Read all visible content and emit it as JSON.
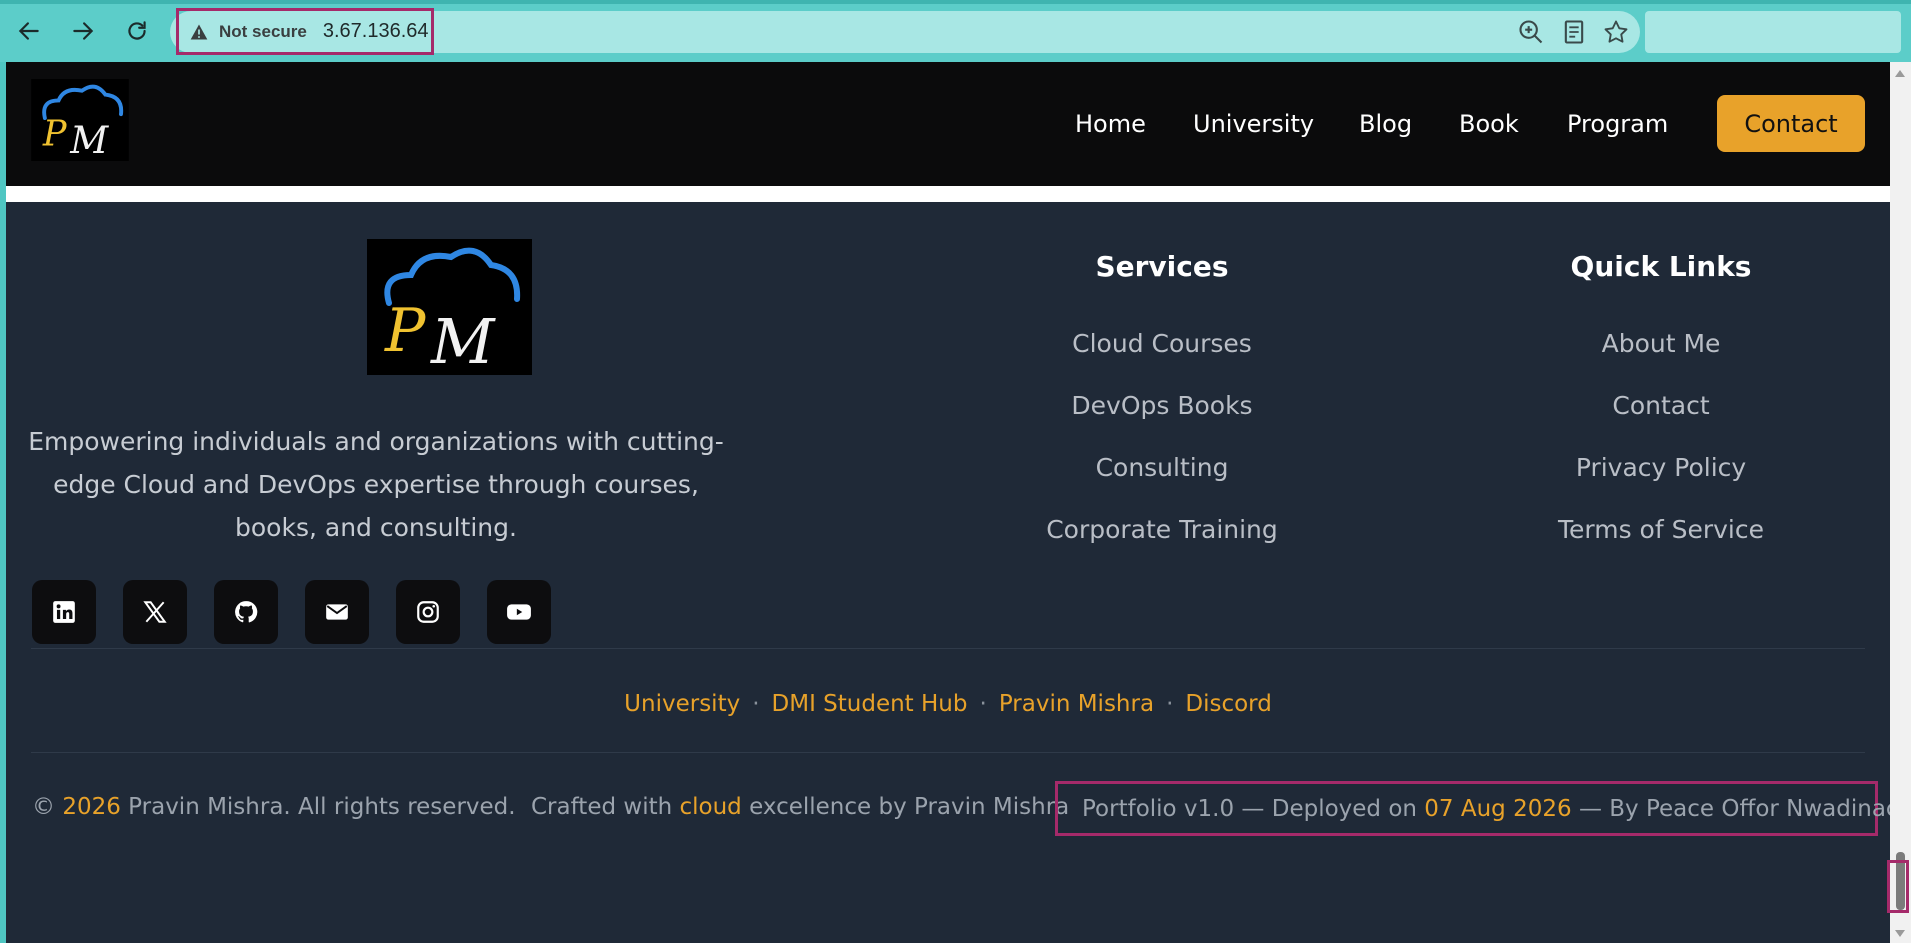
{
  "browser": {
    "security_label": "Not secure",
    "url": "3.67.136.64",
    "icons": [
      "back-icon",
      "forward-icon",
      "reload-icon",
      "warning-icon",
      "zoom-icon",
      "reader-icon",
      "star-icon"
    ]
  },
  "header": {
    "logo_alt": "PM",
    "nav": [
      "Home",
      "University",
      "Blog",
      "Book",
      "Program"
    ],
    "contact_label": "Contact"
  },
  "footer": {
    "tagline": "Empowering individuals and organizations with cutting-edge Cloud and DevOps expertise through courses, books, and consulting.",
    "socials": [
      "linkedin-icon",
      "x-icon",
      "github-icon",
      "email-icon",
      "instagram-icon",
      "youtube-icon"
    ],
    "services": {
      "title": "Services",
      "links": [
        "Cloud Courses",
        "DevOps Books",
        "Consulting",
        "Corporate Training"
      ]
    },
    "quick_links": {
      "title": "Quick Links",
      "links": [
        "About Me",
        "Contact",
        "Privacy Policy",
        "Terms of Service"
      ]
    },
    "bottom_links": [
      "University",
      "DMI Student Hub",
      "Pravin Mishra",
      "Discord"
    ],
    "copyright": {
      "symbol": "©",
      "year": "2026",
      "text": "Pravin Mishra. All rights reserved."
    },
    "crafted": {
      "prefix": "Crafted with",
      "highlight": "cloud",
      "suffix": "excellence by Pravin Mishra"
    },
    "deploy": {
      "prefix": "Portfolio v1.0 — Deployed on",
      "date": "07 Aug 2026",
      "suffix": "— By Peace Offor Nwadinachi"
    }
  },
  "colors": {
    "accent": "#e8a22a",
    "header_bg": "#0b0b0c",
    "footer_bg": "#1f2937",
    "highlight_border": "#a52a6a"
  }
}
